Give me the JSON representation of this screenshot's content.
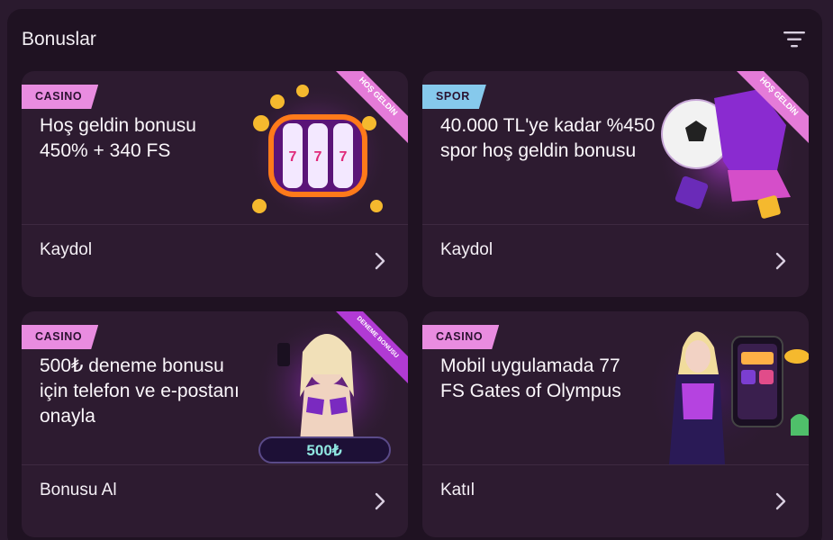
{
  "header": {
    "title": "Bonuslar",
    "filter_icon": "filter-lines-icon"
  },
  "cards": [
    {
      "tag": "CASINO",
      "title": "Hoş geldin bonusu 450% + 340 FS",
      "ribbon": "HOŞ GELDİN",
      "action": "Kaydol",
      "art": "slot-machine-art"
    },
    {
      "tag": "SPOR",
      "title": "40.000 TL'ye kadar %450 spor hoş geldin bonusu",
      "ribbon": "HOŞ GELDİN",
      "action": "Kaydol",
      "art": "football-sneaker-art"
    },
    {
      "tag": "CASINO",
      "title": "500₺ deneme bonusu için telefon ve e-postanı onayla",
      "ribbon": "DENEME BONUSU",
      "badge": "500₺",
      "action": "Bonusu Al",
      "art": "woman-with-phone-art"
    },
    {
      "tag": "CASINO",
      "title": "Mobil uygulamada 77 FS Gates of Olympus",
      "action": "Katıl",
      "art": "cyber-girl-phone-art"
    }
  ],
  "colors": {
    "casino_tag": "#e98ce0",
    "spor_tag": "#86c9ec",
    "card_bg": "#2d1b30",
    "panel_bg": "#1f1222",
    "page_bg": "#2a1a2e",
    "ribbon": "#f0b43c"
  }
}
